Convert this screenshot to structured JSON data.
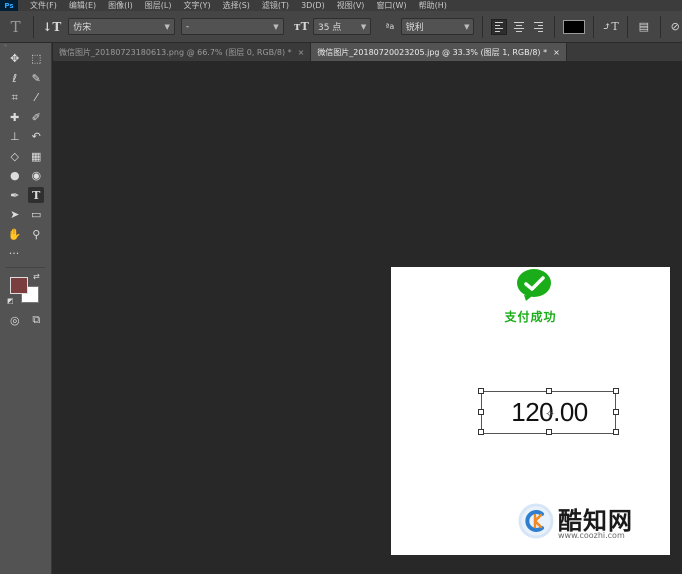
{
  "app": {
    "logo": "Ps"
  },
  "menu": [
    "文件(F)",
    "编辑(E)",
    "图像(I)",
    "图层(L)",
    "文字(Y)",
    "选择(S)",
    "滤镜(T)",
    "3D(D)",
    "视图(V)",
    "窗口(W)",
    "帮助(H)"
  ],
  "options": {
    "font_family": "仿宋",
    "font_style": "-",
    "font_size": "35 点",
    "aa_label": "ªa",
    "antialias": "锐利",
    "text_color": "#000000"
  },
  "tabs": [
    {
      "label": "微信图片_20180723180613.png @ 66.7% (图层 0, RGB/8) *",
      "close": "×"
    },
    {
      "label": "微信图片_20180720023205.jpg @ 33.3% (图层 1, RGB/8) *",
      "close": "×"
    }
  ],
  "colors": {
    "foreground": "#7a3e3e",
    "background": "#ffffff",
    "accent_green": "#1aad19"
  },
  "canvas": {
    "title": "支付成功",
    "amount": "120.00",
    "watermark_text": "酷知网",
    "watermark_url": "www.coozhi.com"
  }
}
